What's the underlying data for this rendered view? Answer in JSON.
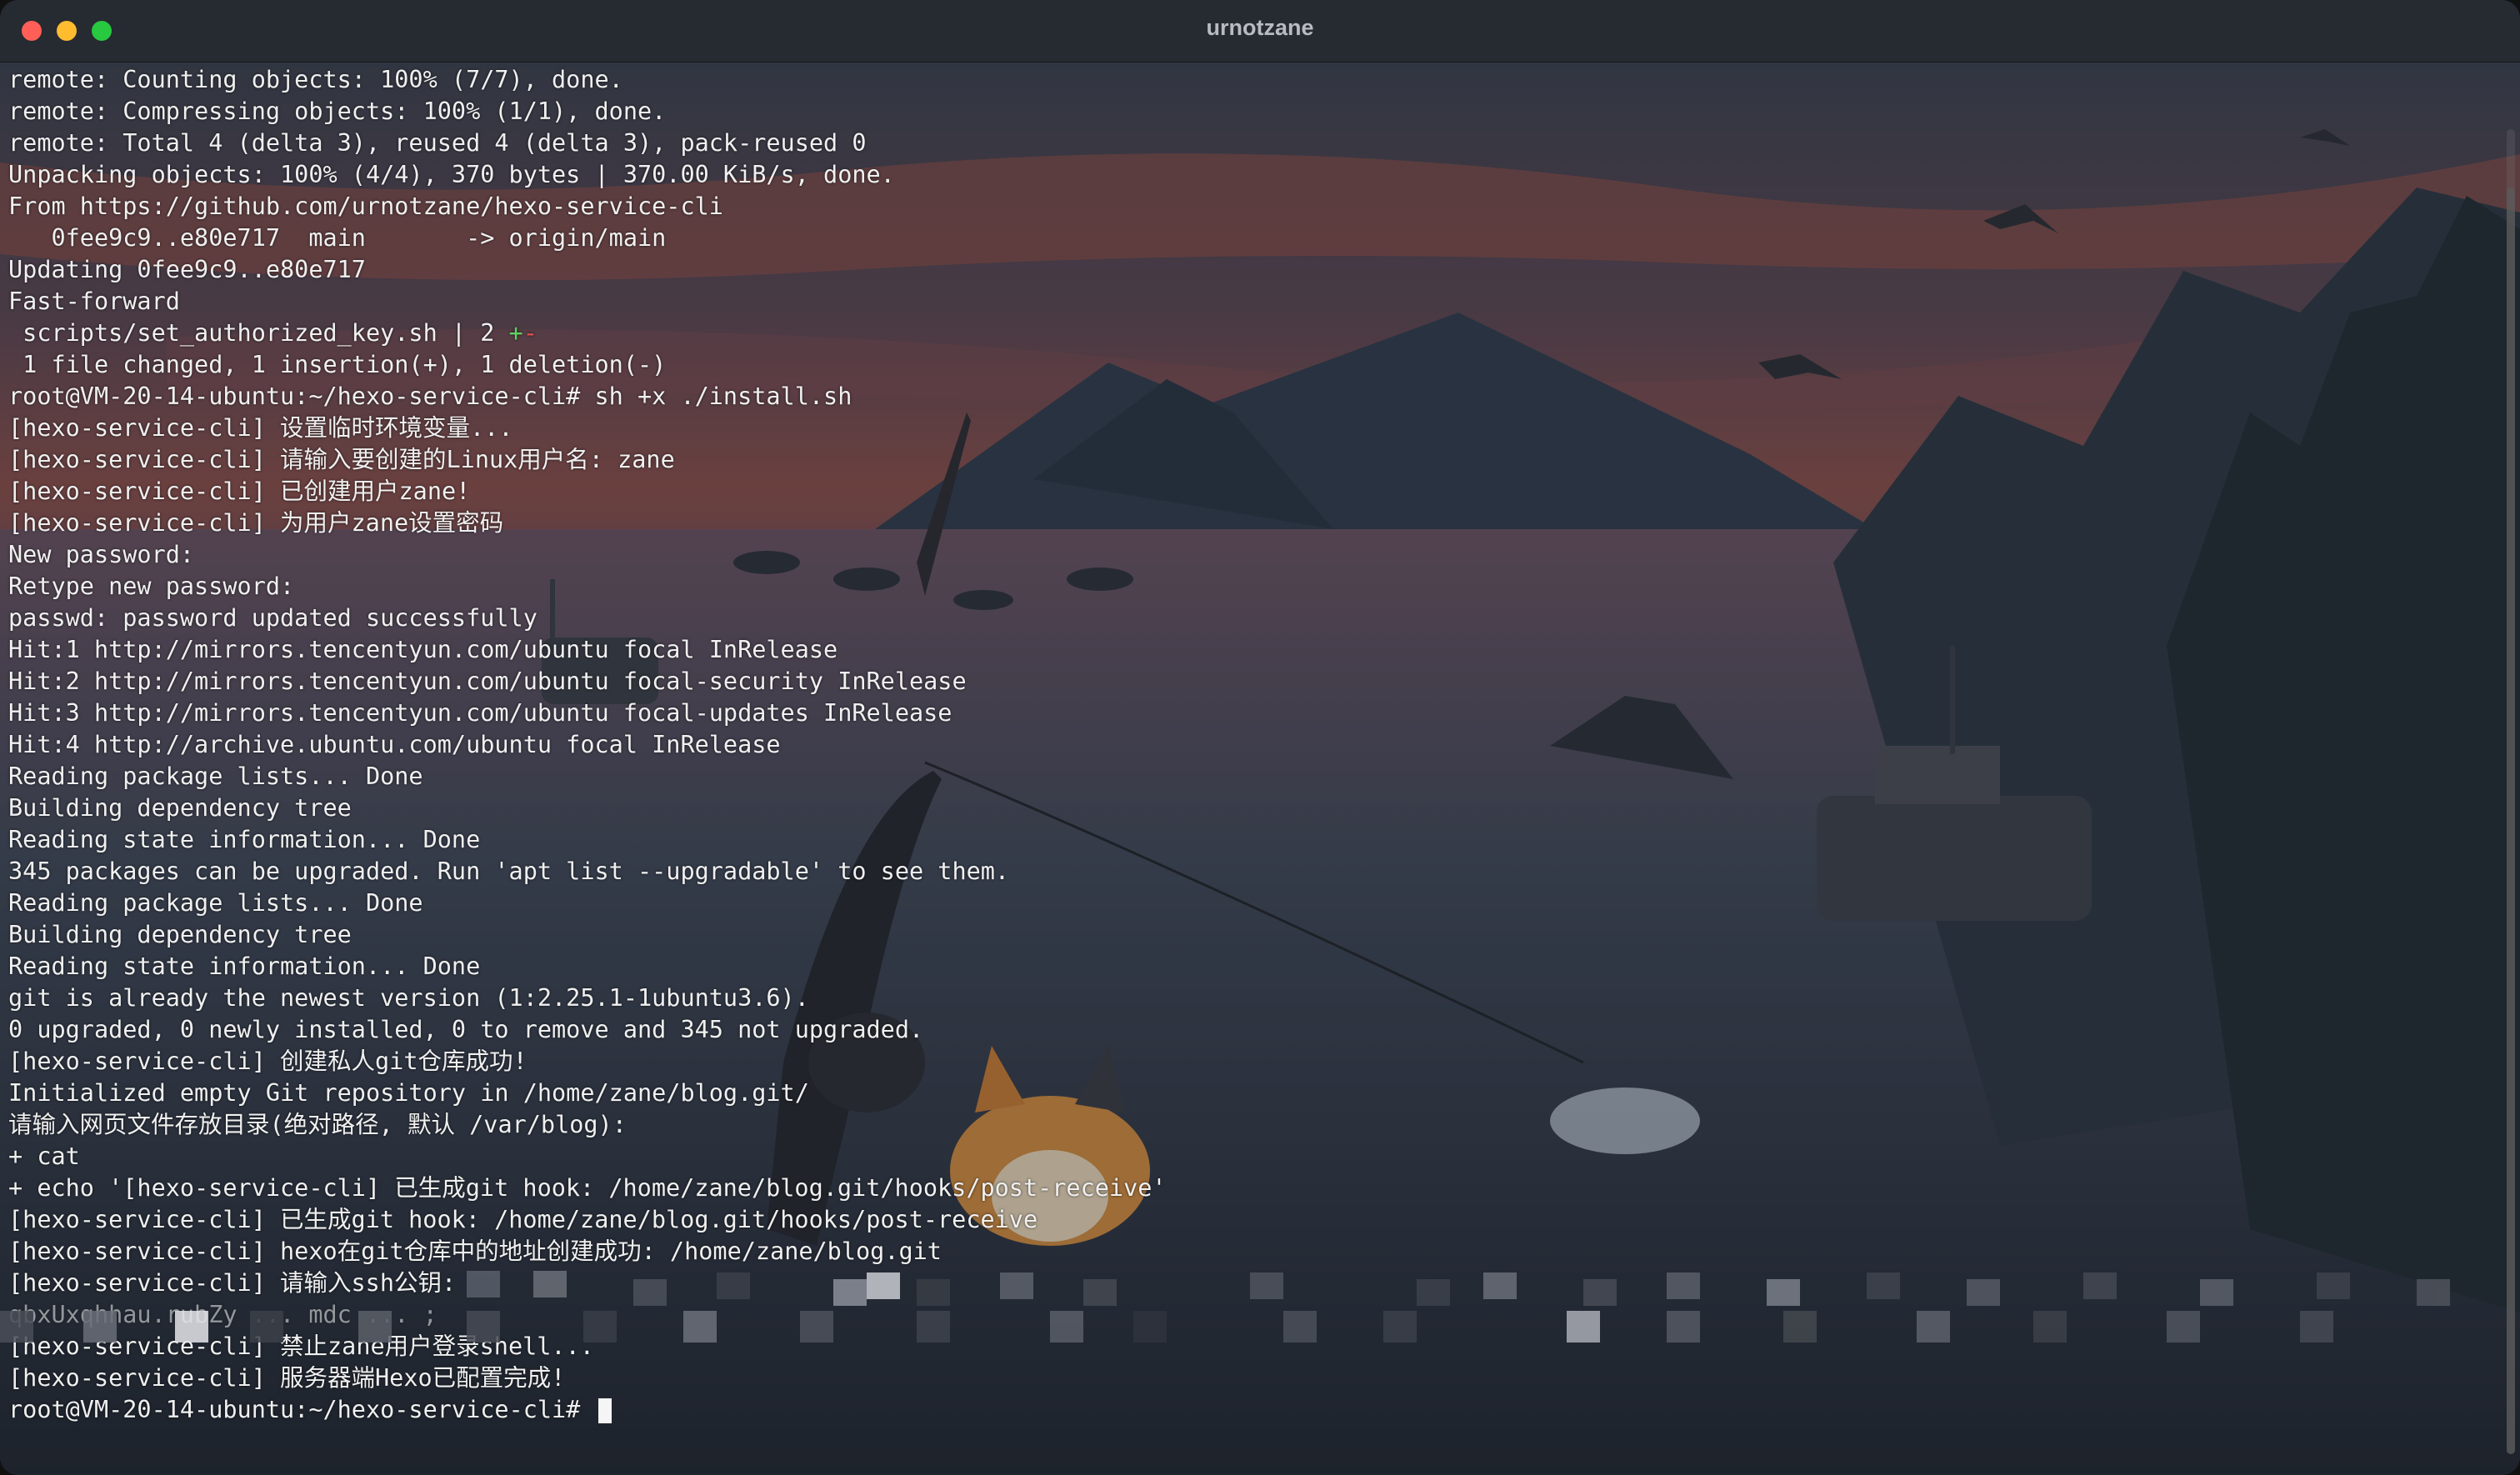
{
  "window": {
    "title": "urnotzane"
  },
  "terminal": {
    "lines": [
      "remote: Counting objects: 100% (7/7), done.",
      "remote: Compressing objects: 100% (1/1), done.",
      "remote: Total 4 (delta 3), reused 4 (delta 3), pack-reused 0",
      "Unpacking objects: 100% (4/4), 370 bytes | 370.00 KiB/s, done.",
      "From https://github.com/urnotzane/hexo-service-cli",
      "   0fee9c9..e80e717  main       -> origin/main",
      "Updating 0fee9c9..e80e717",
      "Fast-forward"
    ],
    "diffstat": {
      "file": " scripts/set_authorized_key.sh | 2 ",
      "plus": "+",
      "minus": "-"
    },
    "lines2": [
      " 1 file changed, 1 insertion(+), 1 deletion(-)",
      "root@VM-20-14-ubuntu:~/hexo-service-cli# sh +x ./install.sh",
      "[hexo-service-cli] 设置临时环境变量...",
      "[hexo-service-cli] 请输入要创建的Linux用户名: zane",
      "[hexo-service-cli] 已创建用户zane!",
      "[hexo-service-cli] 为用户zane设置密码",
      "New password:",
      "Retype new password:",
      "passwd: password updated successfully",
      "Hit:1 http://mirrors.tencentyun.com/ubuntu focal InRelease",
      "Hit:2 http://mirrors.tencentyun.com/ubuntu focal-security InRelease",
      "Hit:3 http://mirrors.tencentyun.com/ubuntu focal-updates InRelease",
      "Hit:4 http://archive.ubuntu.com/ubuntu focal InRelease",
      "Reading package lists... Done",
      "Building dependency tree",
      "Reading state information... Done",
      "345 packages can be upgraded. Run 'apt list --upgradable' to see them.",
      "Reading package lists... Done",
      "Building dependency tree",
      "Reading state information... Done",
      "git is already the newest version (1:2.25.1-1ubuntu3.6).",
      "0 upgraded, 0 newly installed, 0 to remove and 345 not upgraded.",
      "[hexo-service-cli] 创建私人git仓库成功!",
      "Initialized empty Git repository in /home/zane/blog.git/",
      "请输入网页文件存放目录(绝对路径, 默认 /var/blog):",
      "+ cat",
      "+ echo '[hexo-service-cli] 已生成git hook: /home/zane/blog.git/hooks/post-receive'",
      "[hexo-service-cli] 已生成git hook: /home/zane/blog.git/hooks/post-receive",
      "[hexo-service-cli] hexo在git仓库中的地址创建成功: /home/zane/blog.git",
      "[hexo-service-cli] 请输入ssh公钥:"
    ],
    "redacted_line": "qbxUxqhhau.rubZy ... mdc ... ;",
    "lines3": [
      "[hexo-service-cli] 禁止zane用户登录shell...",
      "[hexo-service-cli] 服务器端Hexo已配置完成!"
    ],
    "prompt": "root@VM-20-14-ubuntu:~/hexo-service-cli# "
  },
  "colors": {
    "titlebar": "#262a31",
    "text": "#f0f0f0",
    "diff_plus": "#5fd35f",
    "diff_minus": "#e05050"
  }
}
